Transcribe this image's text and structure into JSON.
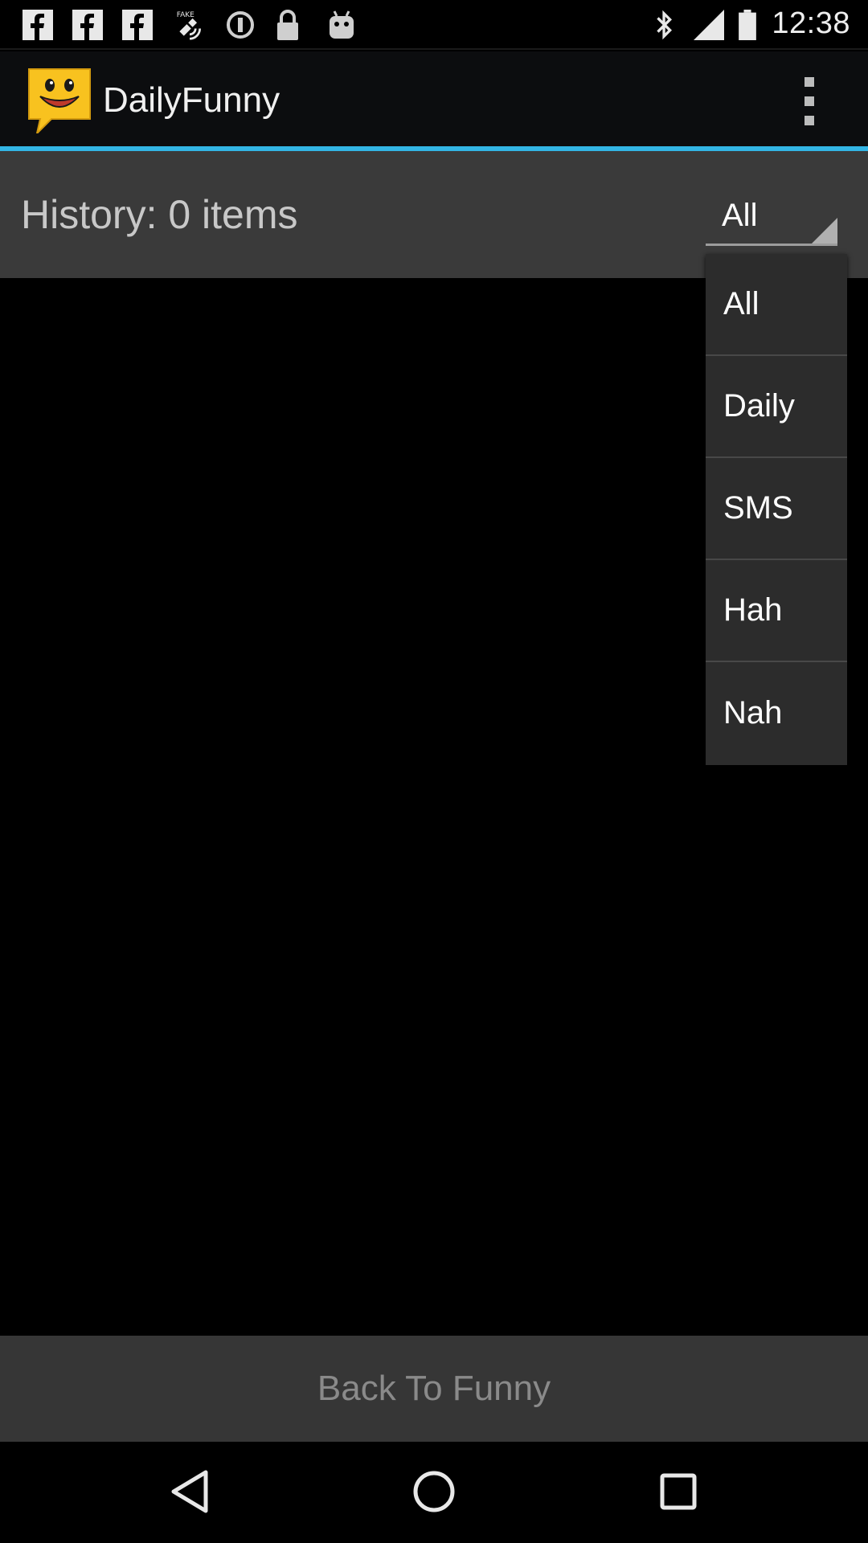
{
  "status_bar": {
    "time": "12:38",
    "icons": [
      "facebook-icon",
      "facebook-icon",
      "facebook-icon",
      "fake-gps-icon",
      "alert-icon",
      "lock-icon",
      "android-icon",
      "bluetooth-icon",
      "signal-icon",
      "battery-icon"
    ]
  },
  "app_bar": {
    "title": "DailyFunny",
    "logo_icon": "smiley-chat-icon",
    "menu_icon": "overflow-menu-icon",
    "accent_color": "#33b5e5"
  },
  "header": {
    "history_label": "History: 0 items",
    "filter_selected": "All"
  },
  "dropdown": {
    "options": [
      "All",
      "Daily",
      "SMS",
      "Hah",
      "Nah"
    ]
  },
  "footer": {
    "back_button_label": "Back To Funny"
  },
  "nav_bar": {
    "icons": [
      "back-icon",
      "home-icon",
      "recents-icon"
    ]
  }
}
